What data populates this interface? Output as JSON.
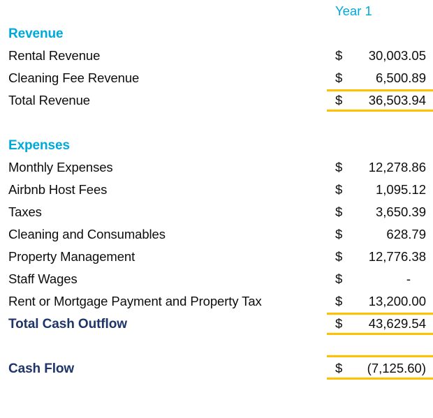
{
  "colors": {
    "accent_cyan": "#00A9DB",
    "total_navy": "#1F3569",
    "rule_gold": "#FFC000",
    "body_text": "#0D0D0D",
    "background": "#FFFFFF"
  },
  "header": {
    "year_column": "Year 1"
  },
  "revenue": {
    "heading": "Revenue",
    "items": [
      {
        "label": "Rental Revenue",
        "currency": "$",
        "amount": "30,003.05"
      },
      {
        "label": "Cleaning Fee Revenue",
        "currency": "$",
        "amount": "6,500.89"
      }
    ],
    "total": {
      "label": "Total Revenue",
      "currency": "$",
      "amount": "36,503.94"
    }
  },
  "expenses": {
    "heading": "Expenses",
    "items": [
      {
        "label": "Monthly Expenses",
        "currency": "$",
        "amount": "12,278.86"
      },
      {
        "label": "Airbnb Host Fees",
        "currency": "$",
        "amount": "1,095.12"
      },
      {
        "label": "Taxes",
        "currency": "$",
        "amount": "3,650.39"
      },
      {
        "label": "Cleaning and Consumables",
        "currency": "$",
        "amount": "628.79"
      },
      {
        "label": "Property Management",
        "currency": "$",
        "amount": "12,776.38"
      },
      {
        "label": "Staff Wages",
        "currency": "$",
        "amount": "-"
      },
      {
        "label": "Rent or Mortgage Payment and Property Tax",
        "currency": "$",
        "amount": "13,200.00"
      }
    ],
    "total": {
      "label": "Total Cash Outflow",
      "currency": "$",
      "amount": "43,629.54"
    }
  },
  "cash_flow": {
    "label": "Cash Flow",
    "currency": "$",
    "amount": "(7,125.60)"
  }
}
